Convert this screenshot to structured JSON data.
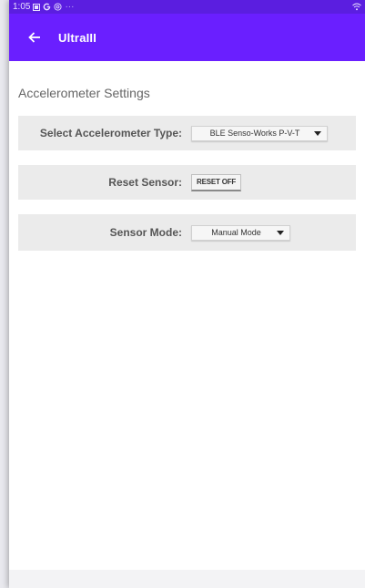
{
  "status_bar": {
    "time": "1:05",
    "icons_left": [
      "notification-icon",
      "google-icon",
      "at-icon",
      "more-dots-icon"
    ],
    "more_dots": "···"
  },
  "app_bar": {
    "title": "UltraIII",
    "back_icon": "arrow-back-icon",
    "color": "#6a1fff"
  },
  "section": {
    "title": "Accelerometer Settings"
  },
  "rows": {
    "accelerometer_type": {
      "label": "Select Accelerometer Type:",
      "value": "BLE Senso-Works P-V-T"
    },
    "reset_sensor": {
      "label": "Reset Sensor:",
      "button": "RESET OFF"
    },
    "sensor_mode": {
      "label": "Sensor Mode:",
      "value": "Manual Mode"
    }
  }
}
